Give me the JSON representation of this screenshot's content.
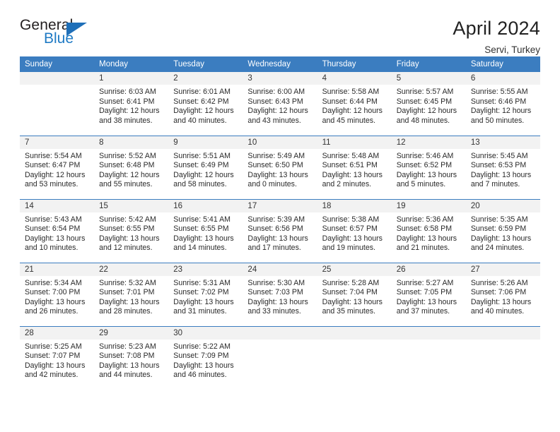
{
  "logo": {
    "word_one": "General",
    "word_two": "Blue",
    "triangle_color": "#1f6fb8",
    "blue_text_color": "#1f7ac4"
  },
  "header": {
    "title": "April 2024",
    "subtitle": "Servi, Turkey"
  },
  "theme": {
    "header_bg": "#3b7dc0",
    "daynum_bg": "#f2f2f2",
    "row_divider": "#3b7dc0",
    "page_bg": "#ffffff",
    "text": "#222222"
  },
  "calendar": {
    "weekday_headers": [
      "Sunday",
      "Monday",
      "Tuesday",
      "Wednesday",
      "Thursday",
      "Friday",
      "Saturday"
    ],
    "weeks": [
      [
        {
          "day": "",
          "lines": []
        },
        {
          "day": "1",
          "lines": [
            "Sunrise: 6:03 AM",
            "Sunset: 6:41 PM",
            "Daylight: 12 hours",
            "and 38 minutes."
          ]
        },
        {
          "day": "2",
          "lines": [
            "Sunrise: 6:01 AM",
            "Sunset: 6:42 PM",
            "Daylight: 12 hours",
            "and 40 minutes."
          ]
        },
        {
          "day": "3",
          "lines": [
            "Sunrise: 6:00 AM",
            "Sunset: 6:43 PM",
            "Daylight: 12 hours",
            "and 43 minutes."
          ]
        },
        {
          "day": "4",
          "lines": [
            "Sunrise: 5:58 AM",
            "Sunset: 6:44 PM",
            "Daylight: 12 hours",
            "and 45 minutes."
          ]
        },
        {
          "day": "5",
          "lines": [
            "Sunrise: 5:57 AM",
            "Sunset: 6:45 PM",
            "Daylight: 12 hours",
            "and 48 minutes."
          ]
        },
        {
          "day": "6",
          "lines": [
            "Sunrise: 5:55 AM",
            "Sunset: 6:46 PM",
            "Daylight: 12 hours",
            "and 50 minutes."
          ]
        }
      ],
      [
        {
          "day": "7",
          "lines": [
            "Sunrise: 5:54 AM",
            "Sunset: 6:47 PM",
            "Daylight: 12 hours",
            "and 53 minutes."
          ]
        },
        {
          "day": "8",
          "lines": [
            "Sunrise: 5:52 AM",
            "Sunset: 6:48 PM",
            "Daylight: 12 hours",
            "and 55 minutes."
          ]
        },
        {
          "day": "9",
          "lines": [
            "Sunrise: 5:51 AM",
            "Sunset: 6:49 PM",
            "Daylight: 12 hours",
            "and 58 minutes."
          ]
        },
        {
          "day": "10",
          "lines": [
            "Sunrise: 5:49 AM",
            "Sunset: 6:50 PM",
            "Daylight: 13 hours",
            "and 0 minutes."
          ]
        },
        {
          "day": "11",
          "lines": [
            "Sunrise: 5:48 AM",
            "Sunset: 6:51 PM",
            "Daylight: 13 hours",
            "and 2 minutes."
          ]
        },
        {
          "day": "12",
          "lines": [
            "Sunrise: 5:46 AM",
            "Sunset: 6:52 PM",
            "Daylight: 13 hours",
            "and 5 minutes."
          ]
        },
        {
          "day": "13",
          "lines": [
            "Sunrise: 5:45 AM",
            "Sunset: 6:53 PM",
            "Daylight: 13 hours",
            "and 7 minutes."
          ]
        }
      ],
      [
        {
          "day": "14",
          "lines": [
            "Sunrise: 5:43 AM",
            "Sunset: 6:54 PM",
            "Daylight: 13 hours",
            "and 10 minutes."
          ]
        },
        {
          "day": "15",
          "lines": [
            "Sunrise: 5:42 AM",
            "Sunset: 6:55 PM",
            "Daylight: 13 hours",
            "and 12 minutes."
          ]
        },
        {
          "day": "16",
          "lines": [
            "Sunrise: 5:41 AM",
            "Sunset: 6:55 PM",
            "Daylight: 13 hours",
            "and 14 minutes."
          ]
        },
        {
          "day": "17",
          "lines": [
            "Sunrise: 5:39 AM",
            "Sunset: 6:56 PM",
            "Daylight: 13 hours",
            "and 17 minutes."
          ]
        },
        {
          "day": "18",
          "lines": [
            "Sunrise: 5:38 AM",
            "Sunset: 6:57 PM",
            "Daylight: 13 hours",
            "and 19 minutes."
          ]
        },
        {
          "day": "19",
          "lines": [
            "Sunrise: 5:36 AM",
            "Sunset: 6:58 PM",
            "Daylight: 13 hours",
            "and 21 minutes."
          ]
        },
        {
          "day": "20",
          "lines": [
            "Sunrise: 5:35 AM",
            "Sunset: 6:59 PM",
            "Daylight: 13 hours",
            "and 24 minutes."
          ]
        }
      ],
      [
        {
          "day": "21",
          "lines": [
            "Sunrise: 5:34 AM",
            "Sunset: 7:00 PM",
            "Daylight: 13 hours",
            "and 26 minutes."
          ]
        },
        {
          "day": "22",
          "lines": [
            "Sunrise: 5:32 AM",
            "Sunset: 7:01 PM",
            "Daylight: 13 hours",
            "and 28 minutes."
          ]
        },
        {
          "day": "23",
          "lines": [
            "Sunrise: 5:31 AM",
            "Sunset: 7:02 PM",
            "Daylight: 13 hours",
            "and 31 minutes."
          ]
        },
        {
          "day": "24",
          "lines": [
            "Sunrise: 5:30 AM",
            "Sunset: 7:03 PM",
            "Daylight: 13 hours",
            "and 33 minutes."
          ]
        },
        {
          "day": "25",
          "lines": [
            "Sunrise: 5:28 AM",
            "Sunset: 7:04 PM",
            "Daylight: 13 hours",
            "and 35 minutes."
          ]
        },
        {
          "day": "26",
          "lines": [
            "Sunrise: 5:27 AM",
            "Sunset: 7:05 PM",
            "Daylight: 13 hours",
            "and 37 minutes."
          ]
        },
        {
          "day": "27",
          "lines": [
            "Sunrise: 5:26 AM",
            "Sunset: 7:06 PM",
            "Daylight: 13 hours",
            "and 40 minutes."
          ]
        }
      ],
      [
        {
          "day": "28",
          "lines": [
            "Sunrise: 5:25 AM",
            "Sunset: 7:07 PM",
            "Daylight: 13 hours",
            "and 42 minutes."
          ]
        },
        {
          "day": "29",
          "lines": [
            "Sunrise: 5:23 AM",
            "Sunset: 7:08 PM",
            "Daylight: 13 hours",
            "and 44 minutes."
          ]
        },
        {
          "day": "30",
          "lines": [
            "Sunrise: 5:22 AM",
            "Sunset: 7:09 PM",
            "Daylight: 13 hours",
            "and 46 minutes."
          ]
        },
        {
          "day": "",
          "lines": []
        },
        {
          "day": "",
          "lines": []
        },
        {
          "day": "",
          "lines": []
        },
        {
          "day": "",
          "lines": []
        }
      ]
    ]
  }
}
